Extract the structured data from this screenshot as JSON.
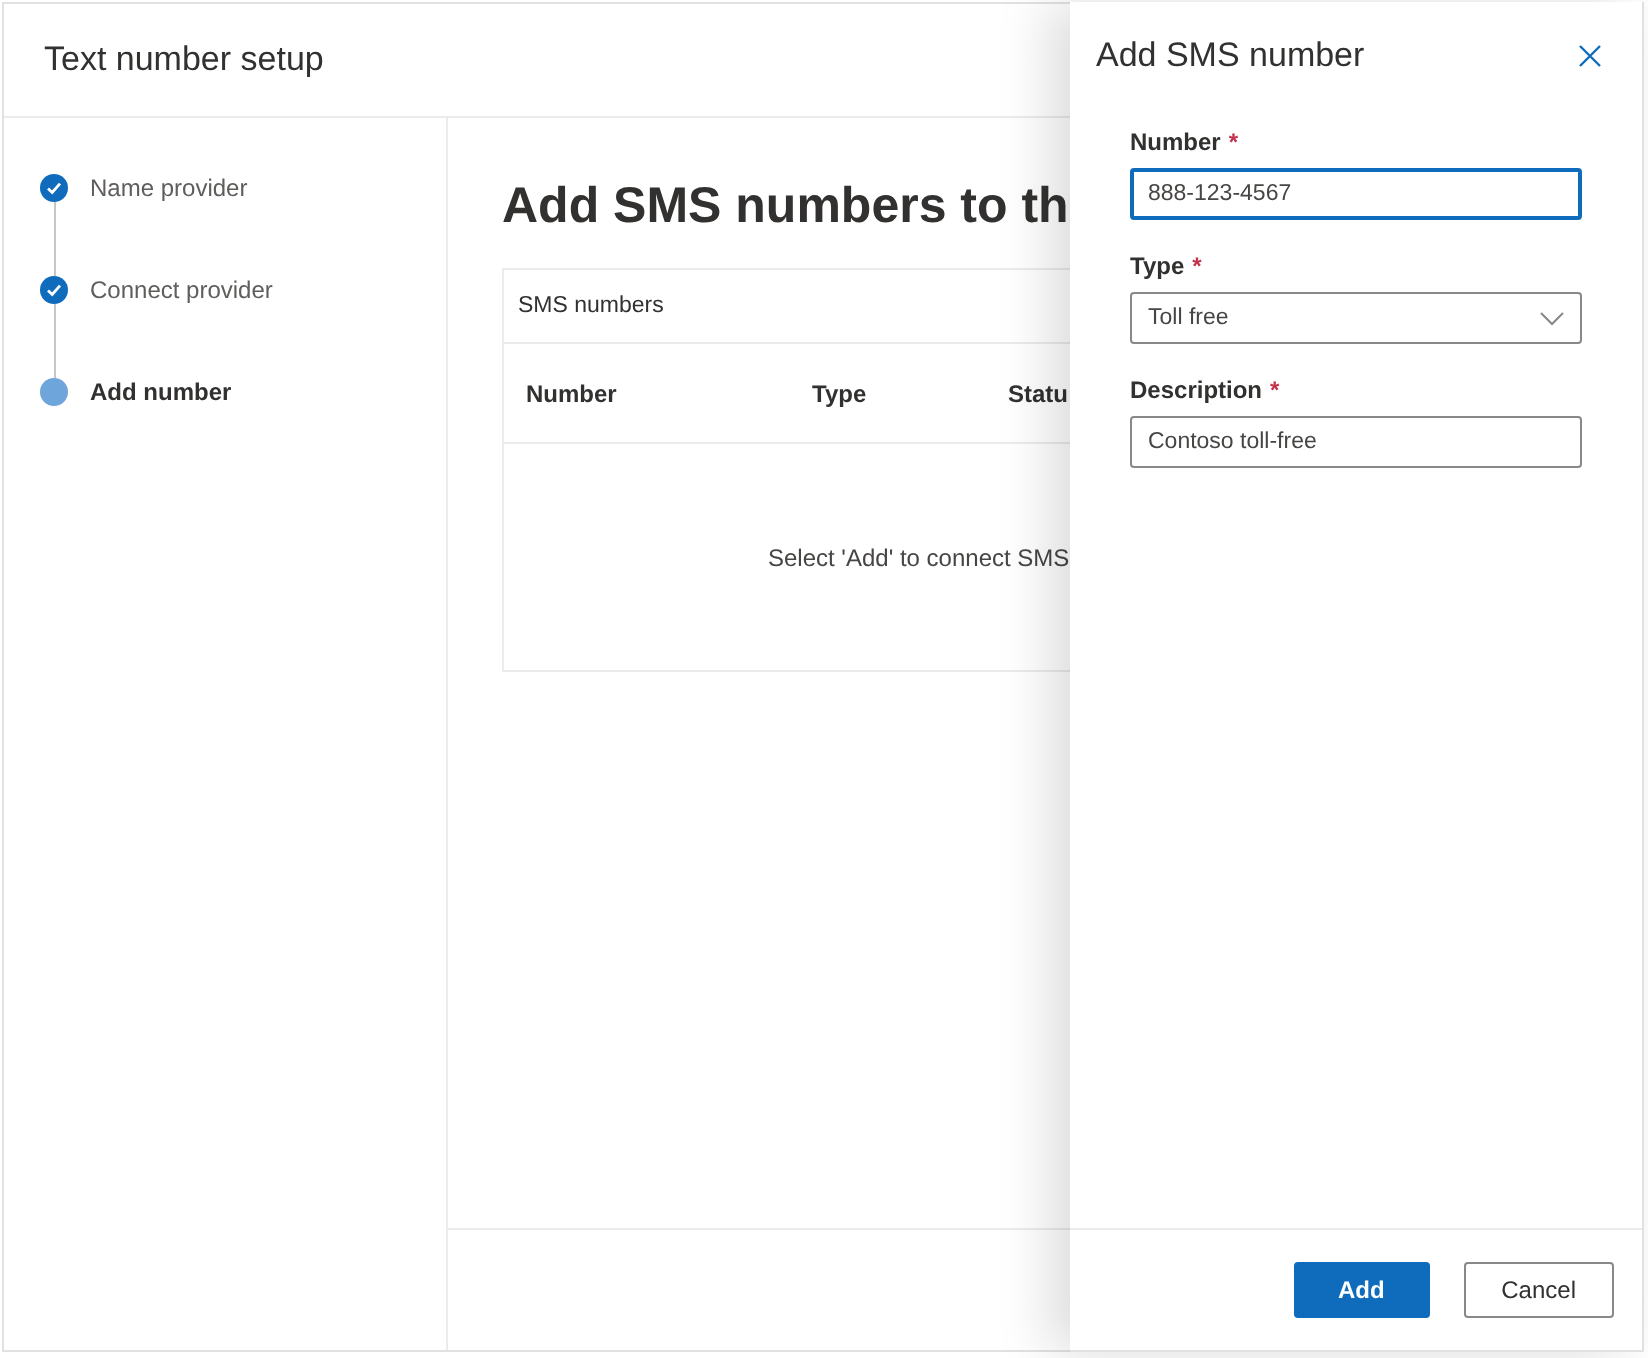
{
  "window": {
    "title": "Text number setup"
  },
  "steps": [
    {
      "label": "Name provider",
      "completed": true,
      "selected": false
    },
    {
      "label": "Connect provider",
      "completed": true,
      "selected": false
    },
    {
      "label": "Add number",
      "completed": false,
      "selected": true
    }
  ],
  "main": {
    "heading": "Add SMS numbers to th",
    "table": {
      "title": "SMS numbers",
      "columns": [
        "Number",
        "Type",
        "Statu"
      ],
      "empty_message": "Select 'Add' to connect SMS"
    }
  },
  "panel": {
    "title": "Add SMS number",
    "fields": [
      {
        "kind": "text",
        "label": "Number",
        "required_mark": "*",
        "value": "888-123-4567",
        "focused": true
      },
      {
        "kind": "dropdown",
        "label": "Type",
        "required_mark": "*",
        "value": "Toll free",
        "focused": false
      },
      {
        "kind": "text",
        "label": "Description",
        "required_mark": "*",
        "value": "Contoso toll-free",
        "focused": false
      }
    ],
    "buttons": [
      {
        "label": "Add",
        "kind": "primary"
      },
      {
        "label": "Cancel",
        "kind": "secondary"
      }
    ]
  }
}
